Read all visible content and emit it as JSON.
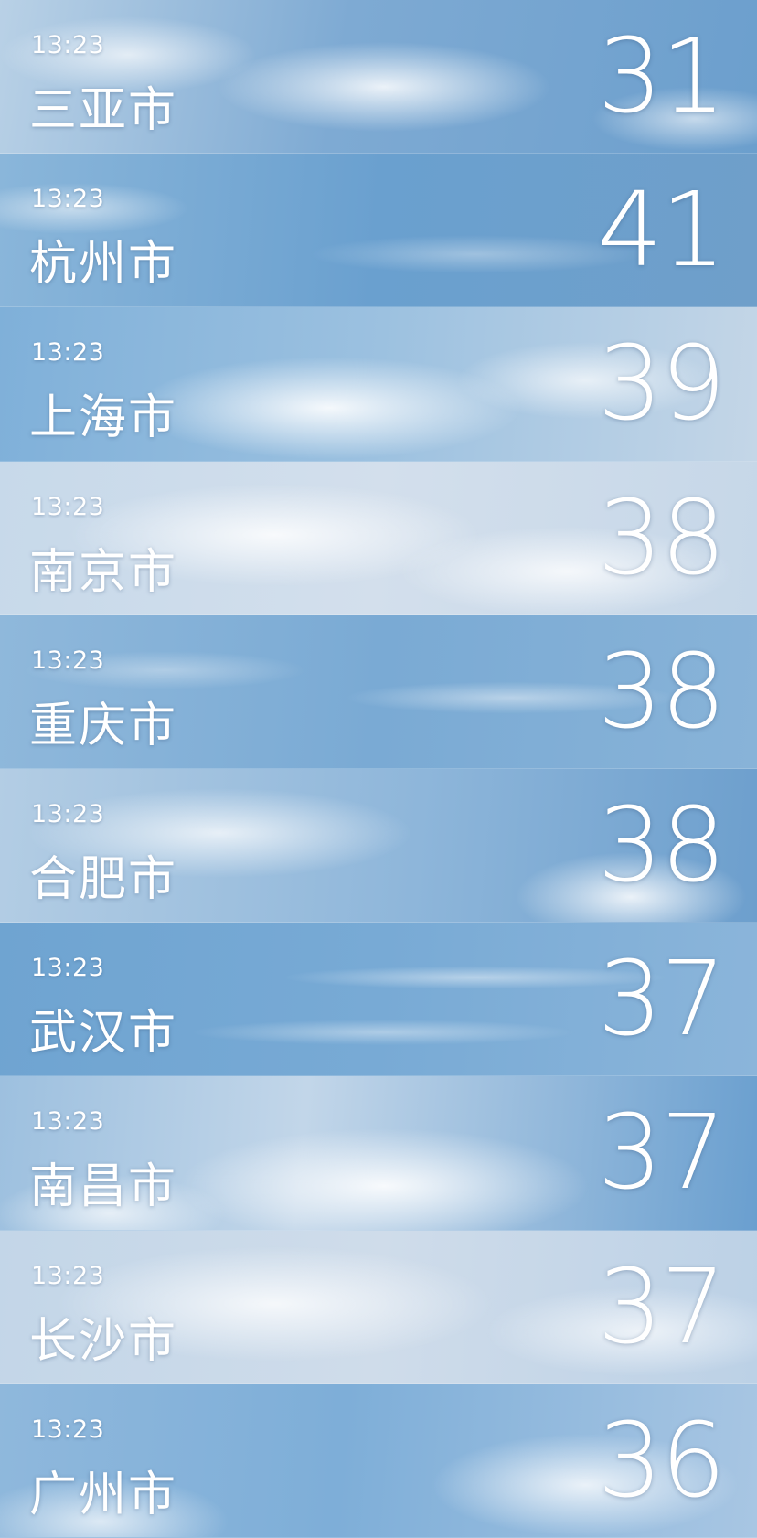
{
  "cities": [
    {
      "time": "13:23",
      "name": "三亚市",
      "temp": "31"
    },
    {
      "time": "13:23",
      "name": "杭州市",
      "temp": "41"
    },
    {
      "time": "13:23",
      "name": "上海市",
      "temp": "39"
    },
    {
      "time": "13:23",
      "name": "南京市",
      "temp": "38"
    },
    {
      "time": "13:23",
      "name": "重庆市",
      "temp": "38"
    },
    {
      "time": "13:23",
      "name": "合肥市",
      "temp": "38"
    },
    {
      "time": "13:23",
      "name": "武汉市",
      "temp": "37"
    },
    {
      "time": "13:23",
      "name": "南昌市",
      "temp": "37"
    },
    {
      "time": "13:23",
      "name": "长沙市",
      "temp": "37"
    },
    {
      "time": "13:23",
      "name": "广州市",
      "temp": "36"
    }
  ]
}
